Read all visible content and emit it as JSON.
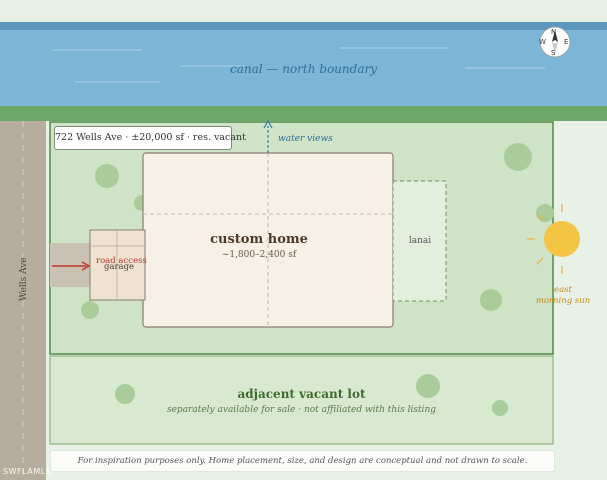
{
  "canal": {
    "label": "canal — north boundary"
  },
  "compass": {
    "n": "N",
    "s": "S",
    "e": "E",
    "w": "W"
  },
  "address_label": "722 Wells Ave · ±20,000 sf · res. vacant",
  "water_views": "water views",
  "home": {
    "title": "custom home",
    "size": "~1,800–2,400 sf"
  },
  "lanai": "lanai",
  "garage": {
    "road_access": "road access",
    "label": "garage"
  },
  "street": "Wells Ave",
  "sun": {
    "east": "east",
    "morning": "morning sun"
  },
  "adjacent": {
    "title": "adjacent vacant lot",
    "subtitle": "separately available for sale · not affiliated with this listing"
  },
  "disclaimer": "For inspiration purposes only. Home placement, size, and design are conceptual and not drawn to scale.",
  "watermark": "SWFLAMLS",
  "colors": {
    "water": "#7bb6d6",
    "grass_strip": "#6da86a",
    "lot": "#cfe3c6",
    "lot_border": "#4f8a45",
    "road": "#b7ad9c",
    "home_fill": "#f6f0e6",
    "home_stroke": "#8a7e70",
    "sun": "#f3c542",
    "arrow": "#c0392b"
  }
}
